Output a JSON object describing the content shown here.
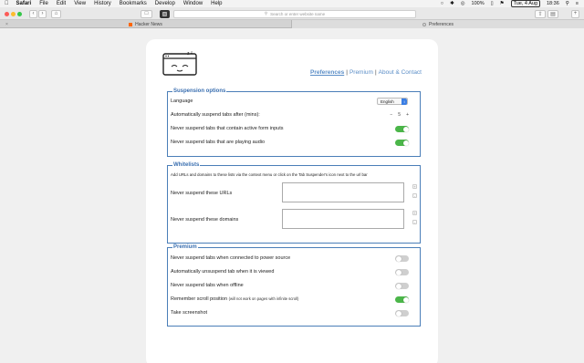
{
  "menubar": {
    "apple": "",
    "items": [
      "Safari",
      "File",
      "Edit",
      "View",
      "History",
      "Bookmarks",
      "Develop",
      "Window",
      "Help"
    ],
    "battery": "100%",
    "date": "Tue, 4 Aug",
    "time": "18:36"
  },
  "toolbar": {
    "address_placeholder": "Search or enter website name"
  },
  "tabs": [
    {
      "label": "Hacker News"
    },
    {
      "label": "Preferences"
    }
  ],
  "page": {
    "nav": {
      "preferences": "Preferences",
      "premium": "Premium",
      "about": "About & Contact",
      "sep": "|"
    },
    "suspension": {
      "legend": "Suspension options",
      "language_label": "Language",
      "language_value": "English",
      "auto_suspend_label": "Automatically suspend tabs after (mins):",
      "auto_suspend_value": "5",
      "minus": "−",
      "plus": "+",
      "form_inputs_label": "Never suspend tabs that contain active form inputs",
      "form_inputs_on": true,
      "audio_label": "Never suspend tabs that are playing audio",
      "audio_on": true
    },
    "whitelists": {
      "legend": "Whitelists",
      "description": "Add URLs and domains to these lists via the context menu or click on the Tab Suspender's icon next to the url bar",
      "urls_label": "Never suspend these URLs",
      "domains_label": "Never suspend these domains",
      "add": "+",
      "remove": "-"
    },
    "premium": {
      "legend": "Premium",
      "power_label": "Never suspend tabs when connected to power source",
      "power_on": false,
      "unsuspend_label": "Automatically unsuspend tab when it is viewed",
      "unsuspend_on": false,
      "offline_label": "Never suspend tabs when offline",
      "offline_on": false,
      "scroll_label": "Remember scroll position",
      "scroll_note": "(will not work on pages with infinite scroll)",
      "scroll_on": true,
      "screenshot_label": "Take screenshot",
      "screenshot_on": false
    }
  }
}
